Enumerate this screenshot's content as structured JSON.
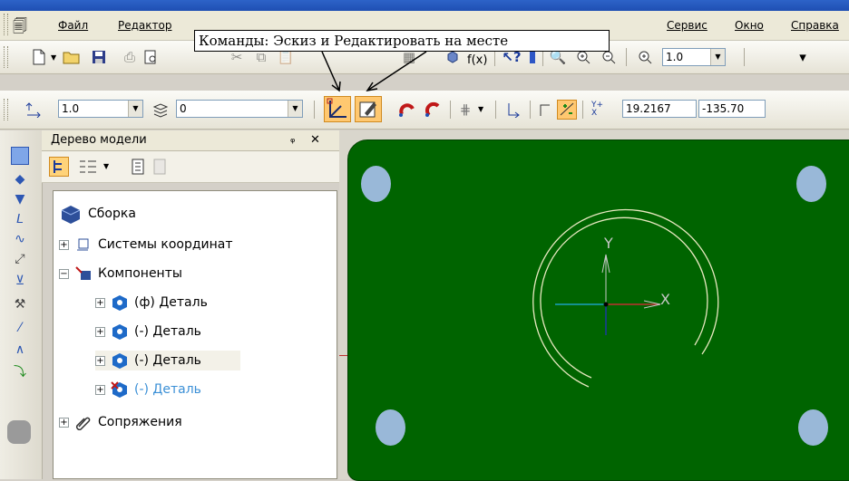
{
  "menu": {
    "items": [
      "Файл",
      "Редактор",
      "Сервис",
      "Окно",
      "Справка"
    ]
  },
  "callout": {
    "text": "Команды:  Эскиз и Редактировать на месте"
  },
  "toolbar1": {
    "fx_label": "f(x)",
    "zoom_value": "1.0"
  },
  "toolbar2": {
    "step_value": "1.0",
    "layer_value": "0",
    "coord_x": "19.2167",
    "coord_y": "-135.70"
  },
  "panel": {
    "title": "Дерево модели",
    "pin": "ᵩ",
    "close": "✕"
  },
  "tree": {
    "root": "Сборка",
    "items": [
      {
        "label": "Системы координат"
      },
      {
        "label": "Компоненты"
      },
      {
        "label": "(ф) Деталь"
      },
      {
        "label": "(-) Деталь"
      },
      {
        "label": "(-) Деталь"
      },
      {
        "label": "(-) Деталь"
      },
      {
        "label": "Сопряжения"
      }
    ]
  },
  "viewport": {
    "axis_x_label": "X",
    "axis_y_label": "Y",
    "plate_color": "#006400",
    "hole_color": "#99b8d8",
    "arc_color": "#e8e8c0"
  },
  "colors": {
    "accent_blue": "#1f4fb3",
    "active_button": "#ffc870",
    "disabled_tree_item": "#3a8fd6"
  }
}
